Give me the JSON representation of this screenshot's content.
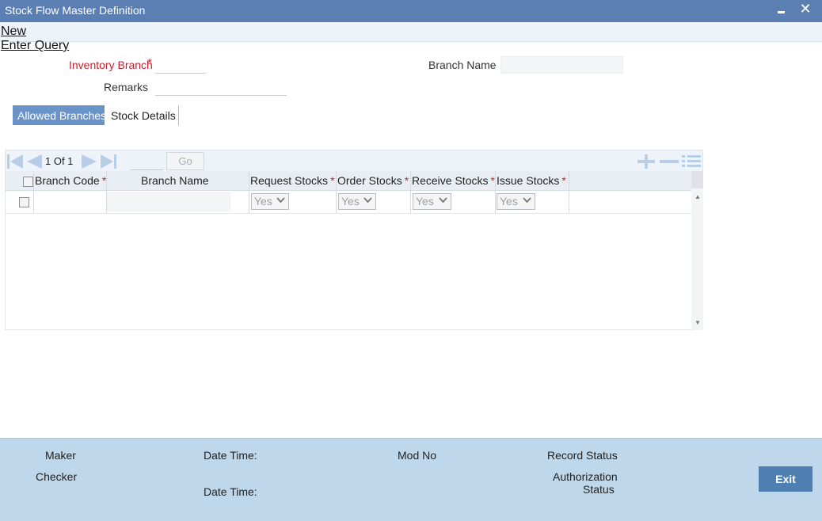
{
  "window": {
    "title": "Stock Flow Master Definition",
    "minimize_icon": "minimize-icon",
    "close_icon": "close-icon",
    "close_glyph": "✕"
  },
  "menu": {
    "new_label": "New",
    "enter_query_label": "Enter Query"
  },
  "form": {
    "inventory_branch_label": "Inventory Branch",
    "inventory_branch_value": "",
    "required_mark": "*",
    "branch_name_label": "Branch Name",
    "branch_name_value": "",
    "remarks_label": "Remarks",
    "remarks_value": ""
  },
  "tabs": [
    {
      "label": "Allowed Branches",
      "active": true
    },
    {
      "label": "Stock Details",
      "active": false
    }
  ],
  "grid": {
    "pager": {
      "text": "1 Of 1",
      "page_input": "",
      "go_label": "Go",
      "icons": [
        "first-page-icon",
        "prev-page-icon",
        "next-page-icon",
        "last-page-icon",
        "add-row-icon",
        "delete-row-icon",
        "single-view-icon"
      ]
    },
    "columns": [
      {
        "label": "Branch Code",
        "required": true
      },
      {
        "label": "Branch Name",
        "required": false
      },
      {
        "label": "Request Stocks",
        "required": true
      },
      {
        "label": "Order Stocks",
        "required": true
      },
      {
        "label": "Receive Stocks",
        "required": true
      },
      {
        "label": "Issue Stocks",
        "required": true
      }
    ],
    "rows": [
      {
        "branch_code": "",
        "branch_name": "",
        "request_stocks": "Yes",
        "order_stocks": "Yes",
        "receive_stocks": "Yes",
        "issue_stocks": "Yes"
      }
    ]
  },
  "footer": {
    "maker_label": "Maker",
    "checker_label": "Checker",
    "maker_date_time_label": "Date Time:",
    "checker_date_time_label": "Date Time:",
    "mod_no_label": "Mod No",
    "record_status_label": "Record Status",
    "authorization_label": "Authorization",
    "status_label": "Status",
    "exit_label": "Exit"
  },
  "colors": {
    "titlebar": "#5b7fb2",
    "active_tab": "#6a93c8",
    "required": "#c8202c",
    "footer": "#bfd7ea",
    "exit_button": "#4d7fb1",
    "nav_icon": "#b8cde6"
  }
}
